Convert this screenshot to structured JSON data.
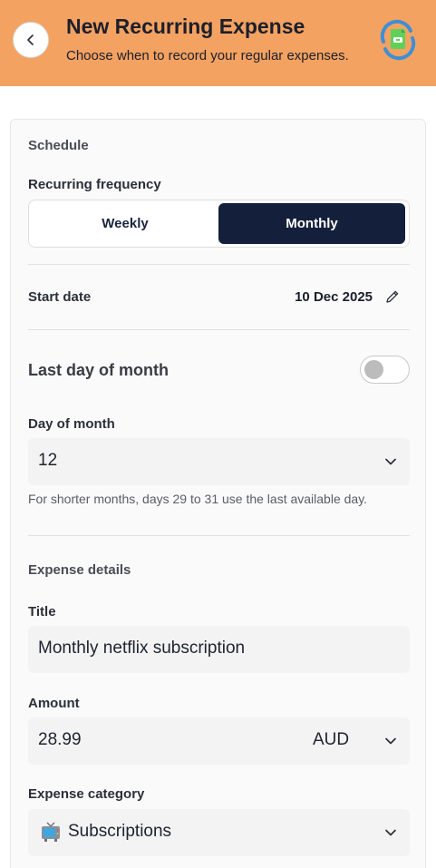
{
  "header": {
    "title": "New Recurring Expense",
    "subtitle": "Choose when to record your regular expenses.",
    "back_icon": "chevron-left-icon",
    "app_icon": "recurring-document-icon",
    "color": "#f4a261"
  },
  "schedule": {
    "section_label": "Schedule",
    "frequency_label": "Recurring frequency",
    "options": [
      "Weekly",
      "Monthly"
    ],
    "selected": "Monthly",
    "start_date_label": "Start date",
    "start_date_value": "10 Dec 2025",
    "last_day_label": "Last day of month",
    "last_day_enabled": false,
    "day_of_month_label": "Day of month",
    "day_of_month_value": "12",
    "hint": "For shorter months, days 29 to 31 use the last available day."
  },
  "details": {
    "section_label": "Expense details",
    "title_label": "Title",
    "title_value": "Monthly netflix subscription",
    "amount_label": "Amount",
    "amount_value": "28.99",
    "currency": "AUD",
    "category_label": "Expense category",
    "category_icon": "television-icon",
    "category_value": "Subscriptions"
  },
  "colors": {
    "accent_dark": "#141f3b",
    "field_bg": "#f3f3f3"
  }
}
